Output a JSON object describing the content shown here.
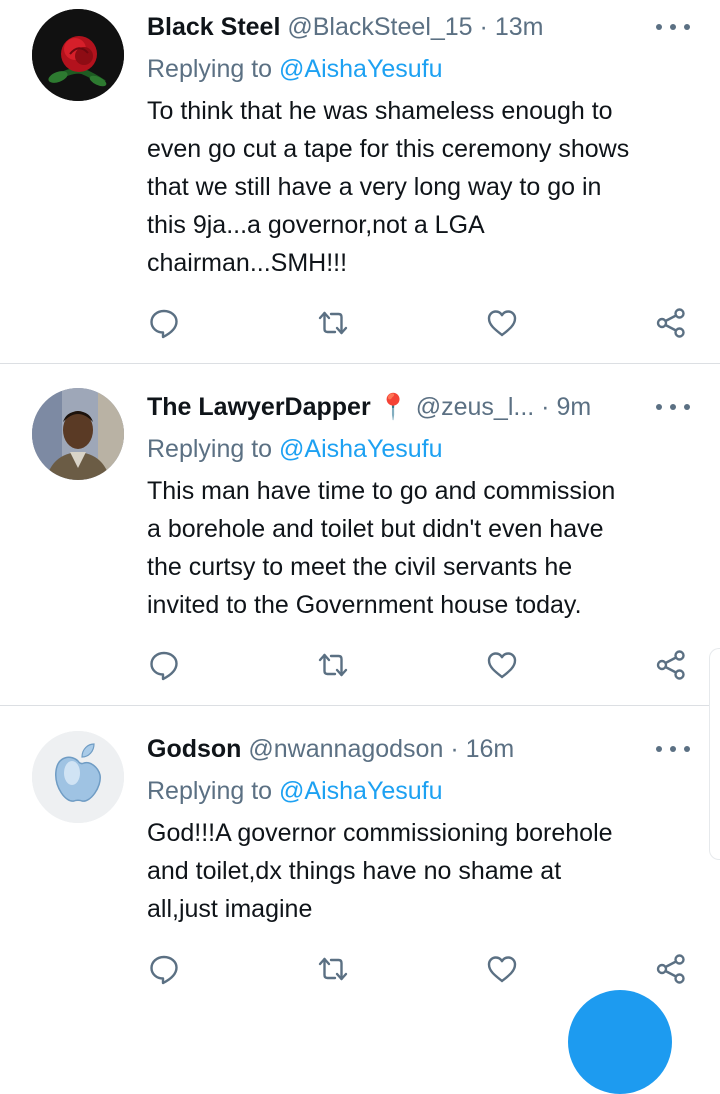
{
  "tweets": [
    {
      "name": "Black Steel",
      "handle": "@BlackSteel_15",
      "separator": "·",
      "time": "13m",
      "replying_prefix": "Replying to",
      "replying_to": "@AishaYesufu",
      "lines": [
        "To think that he was shameless enough to",
        "even go cut a tape for this ceremony shows",
        "that we still have a very long way to go in",
        "this 9ja...a governor,not a LGA",
        "chairman...SMH!!!"
      ],
      "avatar": "rose-avatar"
    },
    {
      "name": "The LawyerDapper",
      "name_icon": "📍",
      "handle": "@zeus_l...",
      "separator": "·",
      "time": "9m",
      "replying_prefix": "Replying to",
      "replying_to": "@AishaYesufu",
      "lines": [
        "This man have time to go and commission",
        "a borehole and toilet but didn't even have",
        "the curtsy to meet the civil servants he",
        "invited to the Government house today."
      ],
      "avatar": "person-avatar"
    },
    {
      "name": "Godson",
      "handle": "@nwannagodson",
      "separator": "·",
      "time": "16m",
      "replying_prefix": "Replying to",
      "replying_to": "@AishaYesufu",
      "lines": [
        "God!!!A governor commissioning borehole",
        "and toilet,dx things have no shame at",
        "all,just imagine"
      ],
      "avatar": "apple-logo-avatar"
    }
  ],
  "icons": {
    "reply": "comment-icon",
    "retweet": "retweet-icon",
    "like": "heart-icon",
    "share": "share-icon",
    "more": "more-options-icon"
  },
  "colors": {
    "name": "#0f1419",
    "secondary": "#5b7083",
    "mention": "#1da1f2",
    "divider": "#dcdfe3",
    "fab": "#1d9bf0"
  }
}
